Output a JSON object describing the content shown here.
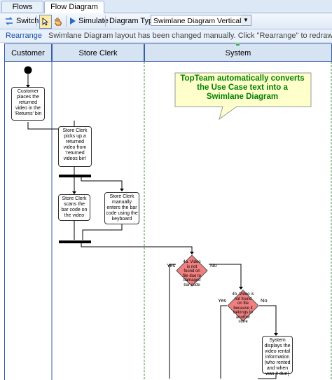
{
  "tabs": [
    {
      "label": "Flows"
    },
    {
      "label": "Flow Diagram"
    }
  ],
  "toolbar": {
    "switch_label": "Switch",
    "simulate_label": "Simulate",
    "diagram_type_label": "Diagram Type:",
    "diagram_type_value": "Swimlane Diagram Vertical"
  },
  "infobar": {
    "link": "Rearrange",
    "message": "Swimlane Diagram layout has been changed manually. Click \"Rearrange\" to redraw Swimlane Diagram from left"
  },
  "lanes": [
    {
      "label": "Customer"
    },
    {
      "label": "Store Clerk"
    },
    {
      "label": "System"
    }
  ],
  "callout": "TopTeam automatically converts the Use Case text into a Swimlane Diagram",
  "nodes": {
    "n1": "Customer places the returned video in the 'Returns' bin",
    "n2": "Store Clerk picks up a returned video from 'returned videos bin'",
    "n3": "Store Clerk scans the bar code on the video",
    "n4": "Store Clerk manually enters the bar code using the keyboard",
    "d1": "4a. Video is not found on file due to damaged bar code",
    "d2": "4b. Video is not found on file because it belongs to another store",
    "n5": "System displays the video rental information (who rented and when was it due)"
  },
  "labels": {
    "yes": "Yes",
    "no": "No"
  },
  "colors": {
    "lane_header": "#d6e3f3",
    "lane_border": "#3a5ea0",
    "callout_fill": "#ffffcc",
    "callout_text": "#008000",
    "diamond": "#f08080"
  }
}
